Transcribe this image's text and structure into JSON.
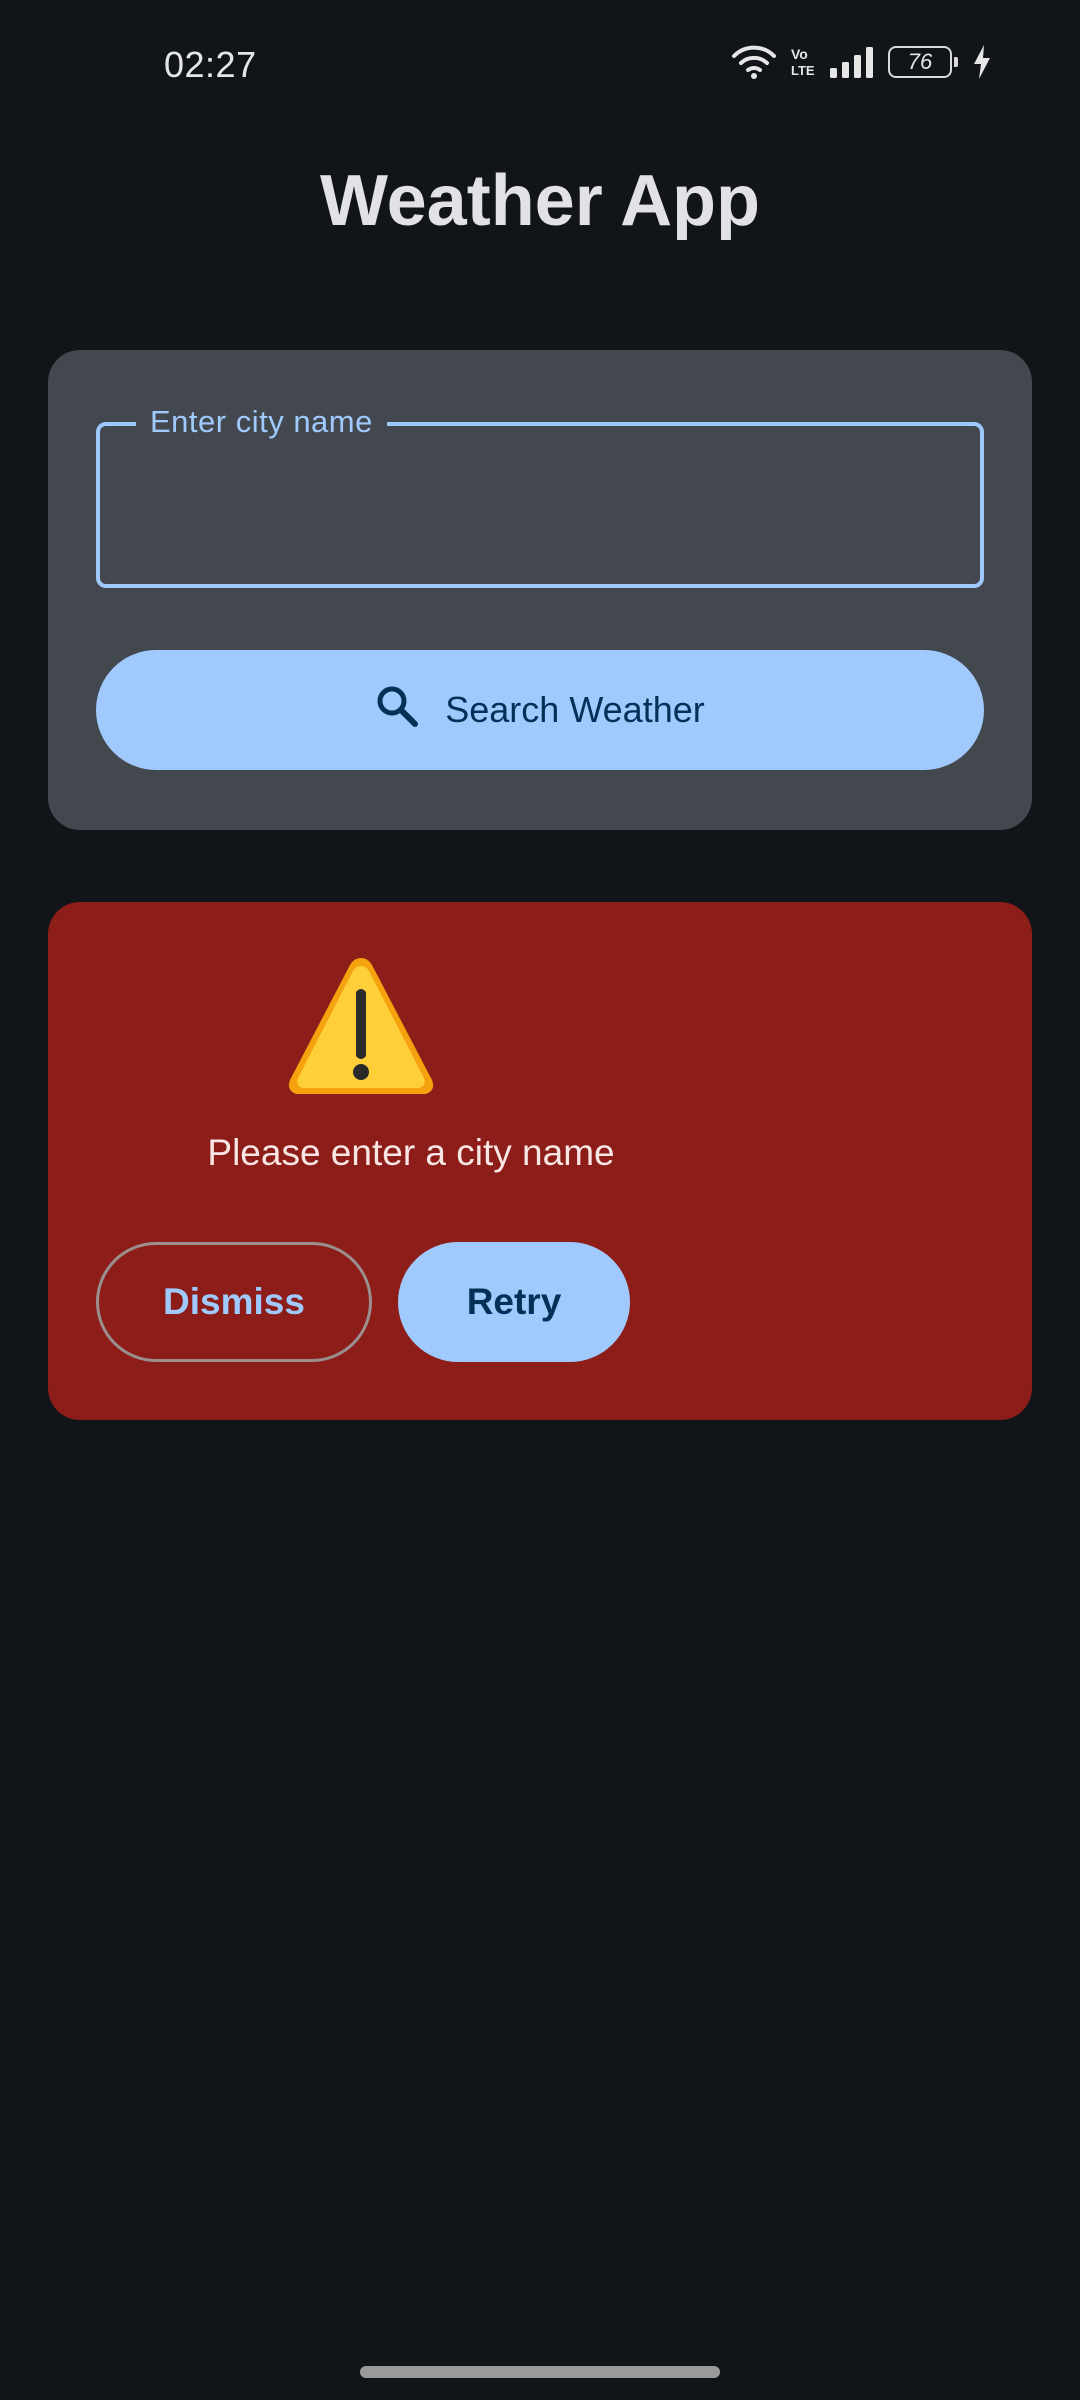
{
  "status_bar": {
    "time": "02:27",
    "battery_level": "76",
    "icons": [
      "wifi-icon",
      "volte-icon",
      "signal-icon",
      "battery-icon",
      "charging-icon"
    ]
  },
  "app": {
    "title": "Weather App"
  },
  "search": {
    "field_label": "Enter city name",
    "value": "",
    "button_label": "Search Weather",
    "button_icon": "search-icon"
  },
  "error": {
    "icon": "warning-icon",
    "message": "Please enter a city name",
    "dismiss_label": "Dismiss",
    "retry_label": "Retry"
  },
  "colors": {
    "background": "#111418",
    "card": "#43474e",
    "accent": "#a0cafd",
    "error_container": "#8c1d18",
    "on_accent": "#003258"
  }
}
